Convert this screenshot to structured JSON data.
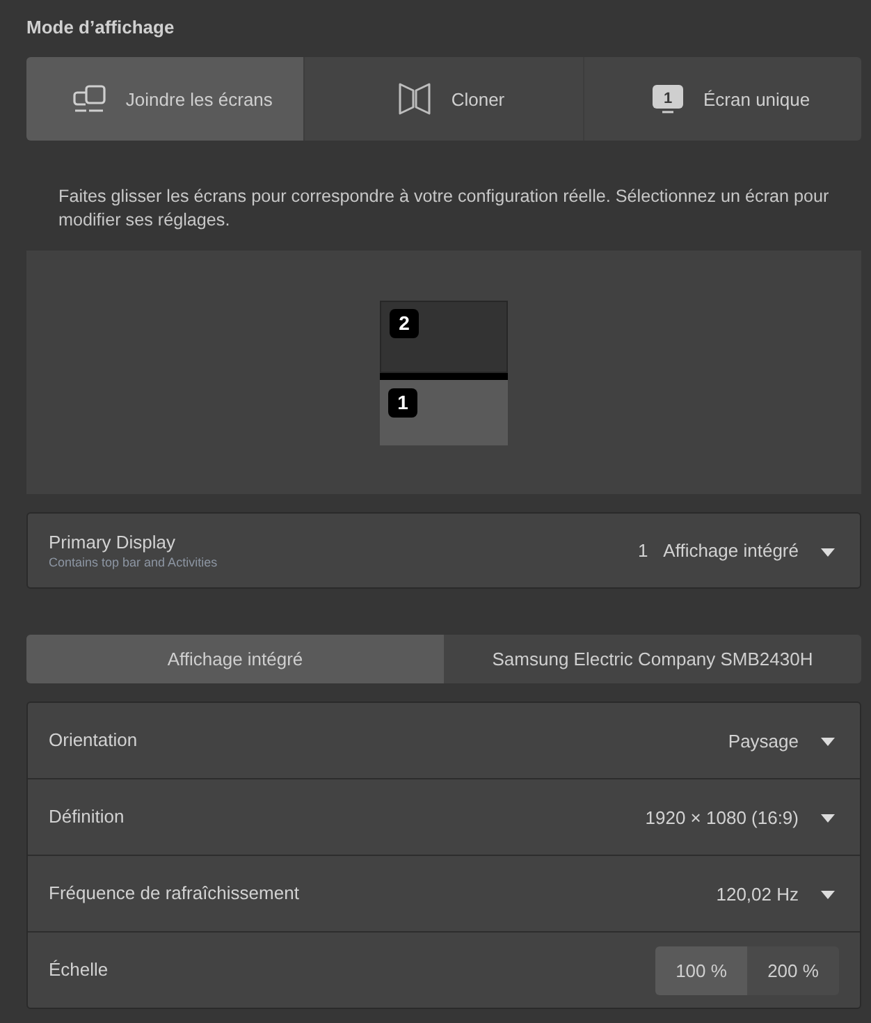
{
  "section_title": "Mode d’affichage",
  "display_modes": [
    {
      "kind": "join",
      "label": "Joindre les écrans",
      "selected": true
    },
    {
      "kind": "mirror",
      "label": "Cloner",
      "selected": false
    },
    {
      "kind": "single",
      "label": "Écran unique",
      "icon_label": "1",
      "selected": false
    }
  ],
  "instructions": "Faites glisser les écrans pour correspondre à votre configuration réelle. Sélectionnez un écran pour modifier ses réglages.",
  "arrangement": {
    "monitors": [
      {
        "number": "2",
        "selected": false,
        "primary": false
      },
      {
        "number": "1",
        "selected": true,
        "primary": true
      }
    ]
  },
  "primary_display": {
    "label": "Primary Display",
    "subtitle": "Contains top bar and Activities",
    "display_number": "1",
    "value": "Affichage intégré"
  },
  "display_tabs": [
    {
      "label": "Affichage intégré",
      "selected": true
    },
    {
      "label": "Samsung Electric Company SMB2430H",
      "selected": false
    }
  ],
  "settings": [
    {
      "kind": "dropdown",
      "label": "Orientation",
      "value": "Paysage"
    },
    {
      "kind": "dropdown",
      "label": "Définition",
      "value": "1920 × 1080 (16:9)"
    },
    {
      "kind": "dropdown",
      "label": "Fréquence de rafraîchissement",
      "value": "120,02 Hz"
    },
    {
      "kind": "toggle_group",
      "label": "Échelle",
      "options": [
        {
          "label": "100 %",
          "selected": true
        },
        {
          "label": "200 %",
          "selected": false
        }
      ]
    }
  ]
}
